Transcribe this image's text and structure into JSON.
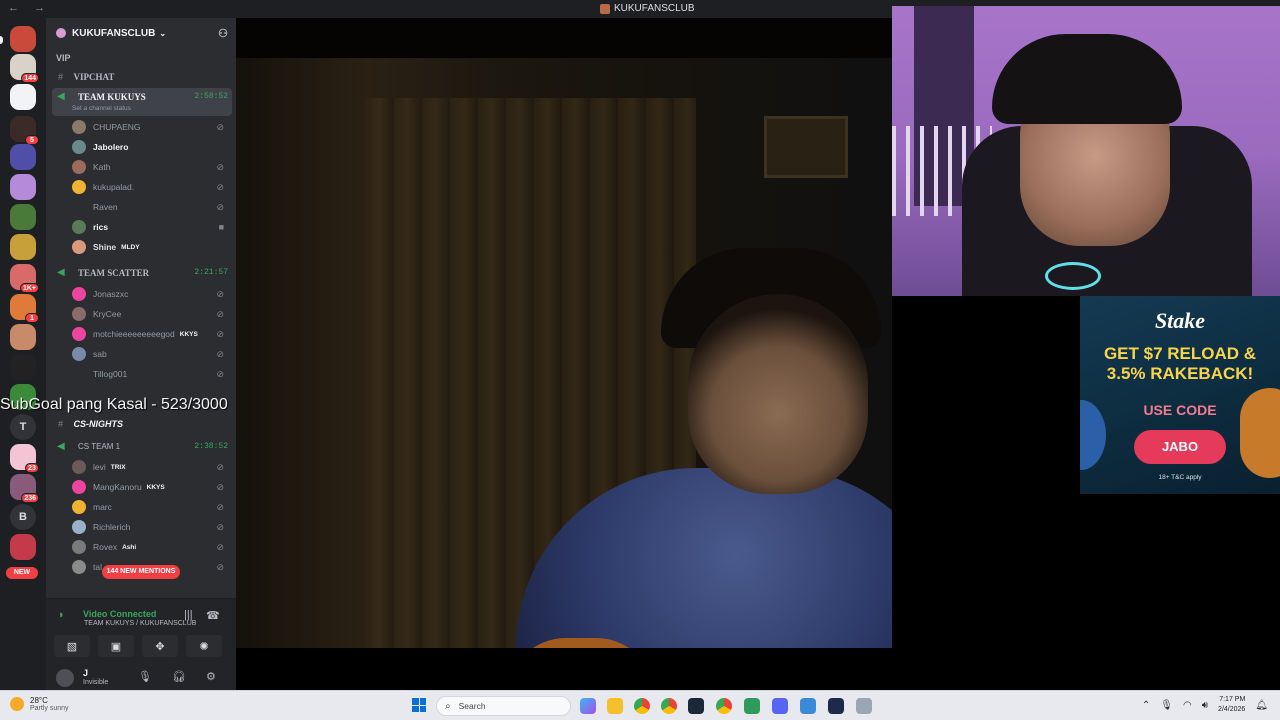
{
  "window": {
    "title": "KUKUFANSCLUB",
    "nav": "← →"
  },
  "colors": {
    "online": "#3ba55c",
    "danger": "#f23f43",
    "sidebar": "#2b2d31",
    "rail": "#1e1f22"
  },
  "rail": {
    "servers": [
      {
        "badge": ""
      },
      {
        "badge": "144"
      },
      {
        "badge": ""
      },
      {
        "badge": "5"
      },
      {
        "badge": ""
      },
      {
        "badge": ""
      },
      {
        "badge": ""
      },
      {
        "badge": ""
      },
      {
        "badge": "1K+"
      },
      {
        "badge": "1"
      },
      {
        "badge": ""
      },
      {
        "badge": ""
      },
      {
        "badge": ""
      }
    ],
    "letter_t": "T",
    "badge_23": "23",
    "badge_236": "236",
    "letter_b": "B",
    "new_label": "NEW"
  },
  "sidebar": {
    "server_name": "KUKUFANSCLUB",
    "vip_category": "VIP",
    "vipchat_channel": "VIPCHAT",
    "team_kukuys": {
      "name": "TEAM KUKUYS",
      "time": "2:58:52",
      "status_placeholder": "Set a channel status"
    },
    "team_kukuys_users": [
      {
        "name": "CHUPAENG",
        "tag": ""
      },
      {
        "name": "Jabolero",
        "tag": ""
      },
      {
        "name": "Kath",
        "tag": ""
      },
      {
        "name": "kukupalad.",
        "tag": ""
      },
      {
        "name": "Raven",
        "tag": ""
      },
      {
        "name": "rics",
        "tag": ""
      },
      {
        "name": "Shine",
        "tag": "MLDY"
      }
    ],
    "team_scatter": {
      "name": "TEAM SCATTER",
      "time": "2:21:57"
    },
    "team_scatter_users": [
      {
        "name": "Jonaszxc",
        "tag": ""
      },
      {
        "name": "KryCee",
        "tag": ""
      },
      {
        "name": "motchieeeeeeeeegod",
        "tag": "KKYS"
      },
      {
        "name": "sab",
        "tag": ""
      },
      {
        "name": "Tillog001",
        "tag": ""
      }
    ],
    "cs_nights_category": "CS-NIGHTS",
    "cs_team": {
      "name": "CS TEAM 1",
      "time": "2:38:52"
    },
    "cs_team_users": [
      {
        "name": "levi",
        "tag": "TRIX"
      },
      {
        "name": "MangKanoru",
        "tag": "KKYS"
      },
      {
        "name": "marc",
        "tag": ""
      },
      {
        "name": "Richlerich",
        "tag": ""
      },
      {
        "name": "Rovex",
        "tag": "Ashi"
      },
      {
        "name": "tal",
        "tag": ""
      }
    ],
    "new_mentions": "144 NEW MENTIONS"
  },
  "voice_panel": {
    "status": "Video Connected",
    "location": "TEAM KUKUYS / KUKUFANSCLUB"
  },
  "user_panel": {
    "name": "J",
    "status": "Invisible"
  },
  "stream": {
    "overlay_text": "SubGoal pang Kasal - 523/3000"
  },
  "ad": {
    "logo": "Stake",
    "headline_1": "GET $7 RELOAD &",
    "headline_2": "3.5% RAKEBACK!",
    "code_label": "USE CODE",
    "code_button": "JABO",
    "terms": "18+ T&C apply"
  },
  "taskbar": {
    "temperature": "28°C",
    "weather": "Partly sunny",
    "search_placeholder": "Search",
    "time": "7:17 PM",
    "date": "2/4/2026"
  }
}
